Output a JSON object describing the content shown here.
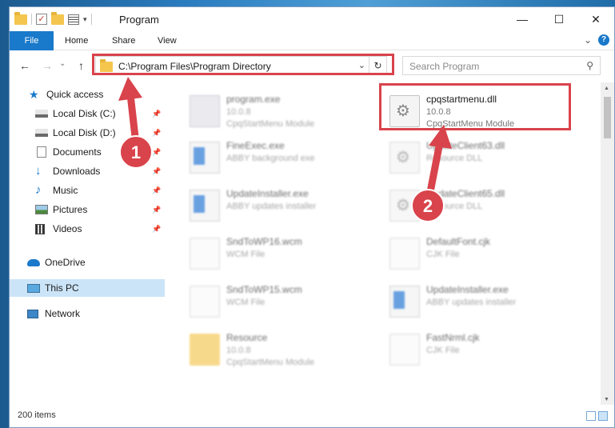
{
  "window": {
    "title": "Program",
    "minimize": "—",
    "maximize": "☐",
    "close": "✕"
  },
  "ribbon": {
    "tabs": [
      "File",
      "Home",
      "Share",
      "View"
    ],
    "expand": "⌄",
    "help": "?"
  },
  "nav": {
    "back": "←",
    "forward": "→",
    "up": "↑",
    "dropdown": "⌄",
    "address": "C:\\Program Files\\Program Directory",
    "refresh": "↻",
    "search_placeholder": "Search Program"
  },
  "sidebar": {
    "items": [
      {
        "label": "Quick access",
        "icon": "star-icon",
        "pinned": false
      },
      {
        "label": "Local Disk (C:)",
        "icon": "drive-icon",
        "pinned": true
      },
      {
        "label": "Local Disk (D:)",
        "icon": "drive-icon",
        "pinned": true
      },
      {
        "label": "Documents",
        "icon": "documents-icon",
        "pinned": true
      },
      {
        "label": "Downloads",
        "icon": "download-icon",
        "pinned": true
      },
      {
        "label": "Music",
        "icon": "music-icon",
        "pinned": true
      },
      {
        "label": "Pictures",
        "icon": "pictures-icon",
        "pinned": true
      },
      {
        "label": "Videos",
        "icon": "videos-icon",
        "pinned": true
      },
      {
        "label": "OneDrive",
        "icon": "cloud-icon",
        "pinned": false
      },
      {
        "label": "This PC",
        "icon": "computer-icon",
        "pinned": false,
        "selected": true
      },
      {
        "label": "Network",
        "icon": "network-icon",
        "pinned": false
      }
    ],
    "pin_glyph": "📌"
  },
  "files": [
    {
      "name": "program.exe",
      "l2": "10.0.8",
      "l3": "CpqStartMenu Module",
      "icon": "app-icon",
      "blurred": true
    },
    {
      "name": "cpqstartmenu.dll",
      "l2": "10.0.8",
      "l3": "CpqStartMenu Module",
      "icon": "dll-gear-icon",
      "blurred": false,
      "highlighted": true
    },
    {
      "name": "FineExec.exe",
      "l2": "ABBY background exe",
      "l3": "",
      "icon": "exe-icon",
      "blurred": true
    },
    {
      "name": "UpdateClient63.dll",
      "l2": "Resource DLL",
      "l3": "",
      "icon": "dll-gear-icon",
      "blurred": true
    },
    {
      "name": "UpdateInstaller.exe",
      "l2": "ABBY updates installer",
      "l3": "",
      "icon": "exe-icon",
      "blurred": true
    },
    {
      "name": "UpdateClient65.dll",
      "l2": "Resource DLL",
      "l3": "",
      "icon": "dll-gear-icon",
      "blurred": true
    },
    {
      "name": "SndToWP16.wcm",
      "l2": "WCM File",
      "l3": "",
      "icon": "doc-icon",
      "blurred": true
    },
    {
      "name": "DefaultFont.cjk",
      "l2": "CJK File",
      "l3": "",
      "icon": "doc-icon",
      "blurred": true
    },
    {
      "name": "SndToWP15.wcm",
      "l2": "WCM File",
      "l3": "",
      "icon": "doc-icon",
      "blurred": true
    },
    {
      "name": "UpdateInstaller.exe",
      "l2": "ABBY updates installer",
      "l3": "",
      "icon": "exe-icon",
      "blurred": true
    },
    {
      "name": "Resource",
      "l2": "10.0.8",
      "l3": "CpqStartMenu Module",
      "icon": "folder-icon",
      "blurred": true
    },
    {
      "name": "FastNrml.cjk",
      "l2": "CJK File",
      "l3": "",
      "icon": "doc-icon",
      "blurred": true
    }
  ],
  "status": {
    "count": "200 items"
  },
  "annotations": {
    "badge1": "1",
    "badge2": "2",
    "color": "#d9434b"
  }
}
